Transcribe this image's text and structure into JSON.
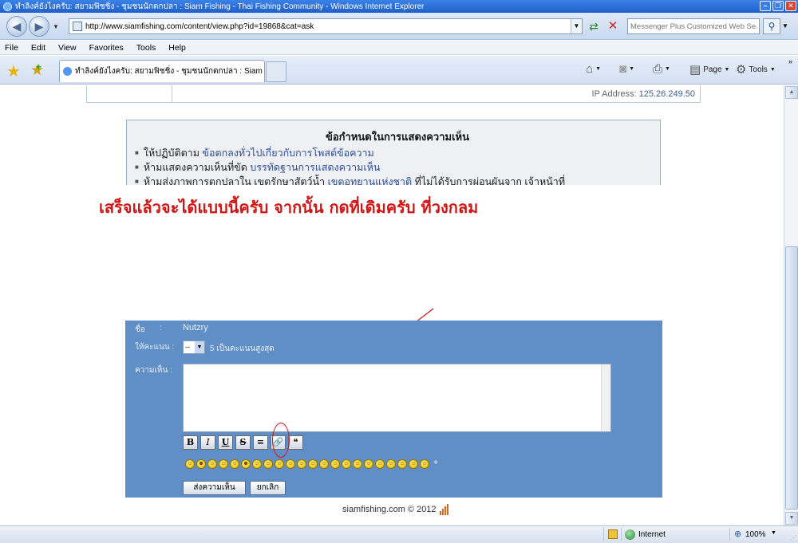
{
  "window": {
    "title": "ทำลิงค์ยังไงครับ: สยามฟิชชิ่ง - ชุมชนนักตกปลา : Siam Fishing - Thai Fishing Community - Windows Internet Explorer",
    "min": "–",
    "max": "❐",
    "close": "✕"
  },
  "addressbar": {
    "url": "http://www.siamfishing.com/content/view.php?id=19868&cat=ask",
    "search_placeholder": "Messenger Plus Customized Web Sear"
  },
  "menu": [
    "File",
    "Edit",
    "View",
    "Favorites",
    "Tools",
    "Help"
  ],
  "tab": {
    "title": "ทำลิงค์ยังไงครับ: สยามฟิชชิ่ง - ชุมชนนักตกปลา : Siam Fi..."
  },
  "commands": {
    "page": "Page",
    "tools": "Tools"
  },
  "content": {
    "ip_label": "IP Address:",
    "ip_value": "125.26.249.50",
    "rules": {
      "heading": "ข้อกำหนดในการแสดงความเห็น",
      "items": [
        {
          "prefix": "ให้ปฏิบัติตาม ",
          "link": "ข้อตกลงทั่วไปเกี่ยวกับการโพสต์ข้อความ",
          "suffix": ""
        },
        {
          "prefix": "ห้ามแสดงความเห็นที่ขัด ",
          "link": "บรรทัดฐานการแสดงความเห็น",
          "suffix": ""
        },
        {
          "prefix": "ห้ามส่งภาพการตกปลาใน เขตรักษาสัตว์น้ำ ",
          "link": "เขตอุทยานแห่งชาติ",
          "suffix": " ที่ไม่ได้รับการผ่อนผันจาก เจ้าหน้าที่"
        }
      ]
    },
    "caption": "เสร็จแล้วจะได้แบบนี้ครับ  จากนั้น กดที่เดิมครับ ที่วงกลม",
    "form": {
      "name_label": "ชื่อ",
      "name_colon": ":",
      "name_value": "Nutzry",
      "rating_label": "ให้คะแนน :",
      "rating_value": "--",
      "rating_hint": "5 เป็นคะแนนสูงสุด",
      "comment_label": "ความเห็น :",
      "toolbar": [
        {
          "name": "bold-button",
          "label": "B",
          "cls": "b"
        },
        {
          "name": "italic-button",
          "label": "I",
          "cls": "i"
        },
        {
          "name": "underline-button",
          "label": "U",
          "cls": "u"
        },
        {
          "name": "strike-button",
          "label": "S",
          "cls": "s"
        },
        {
          "name": "center-button",
          "label": "≡",
          "cls": ""
        },
        {
          "name": "insert-link-button",
          "label": "🔗",
          "cls": ""
        },
        {
          "name": "quote-button",
          "label": "❝",
          "cls": ""
        }
      ],
      "smileys": [
        "☺",
        "☻",
        "☺",
        "☺",
        "☺",
        "☻",
        "☺",
        "☺",
        "☺",
        "☺",
        "☺",
        "☺",
        "☺",
        "☺",
        "☺",
        "☺",
        "☺",
        "☺",
        "☺",
        "☺",
        "☺",
        "☺"
      ],
      "submit_label": "ส่งความเห็น",
      "cancel_label": "ยกเลิก"
    },
    "footer": "siamfishing.com © 2012"
  },
  "status": {
    "zone": "Internet",
    "zoom": "100%"
  },
  "colors": {
    "form_bg": "#5f8fc6",
    "annotation_red": "#d11515",
    "link": "#2d4c99"
  }
}
